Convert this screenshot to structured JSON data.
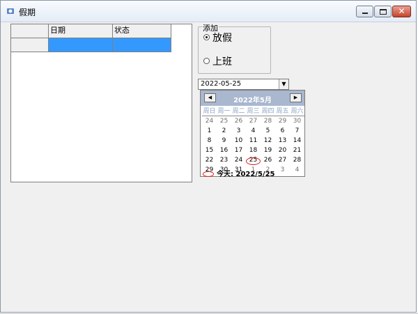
{
  "window": {
    "title": "假期",
    "close_glyph": "✕"
  },
  "grid": {
    "columns": [
      "",
      "日期",
      "状态"
    ]
  },
  "group": {
    "label": "添加",
    "options": [
      {
        "label": "放假",
        "selected": true
      },
      {
        "label": "上班",
        "selected": false
      }
    ]
  },
  "date_picker": {
    "value": "2022-05-25",
    "month_title": "2022年5月",
    "weekdays": [
      "周日",
      "周一",
      "周二",
      "周三",
      "周四",
      "周五",
      "周六"
    ],
    "days": [
      [
        "24",
        "25",
        "26",
        "27",
        "28",
        "29",
        "30"
      ],
      [
        "1",
        "2",
        "3",
        "4",
        "5",
        "6",
        "7"
      ],
      [
        "8",
        "9",
        "10",
        "11",
        "12",
        "13",
        "14"
      ],
      [
        "15",
        "16",
        "17",
        "18",
        "19",
        "20",
        "21"
      ],
      [
        "22",
        "23",
        "24",
        "25",
        "26",
        "27",
        "28"
      ],
      [
        "29",
        "30",
        "31",
        "1",
        "2",
        "3",
        "4"
      ]
    ],
    "selected_day": "25",
    "today_label": "今天: 2022/5/25"
  },
  "colors": {
    "selection": "#3399ff",
    "calendar_header": "#a9b7cf",
    "weekday_text": "#8ba4c8",
    "today_ring": "#dd2222"
  },
  "icons": {
    "title": "app-icon",
    "prev": "triangle-left-icon",
    "next": "triangle-right-icon",
    "dropdown": "chevron-down-icon"
  }
}
